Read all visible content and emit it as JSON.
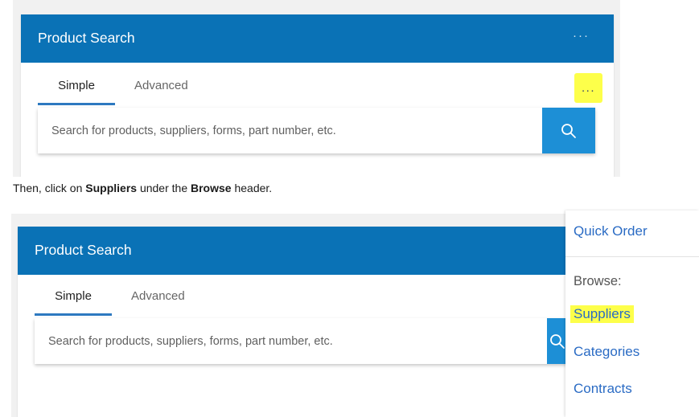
{
  "screenshot1": {
    "title": "Product Search",
    "header_menu": "···",
    "tabs": [
      "Simple",
      "Advanced"
    ],
    "more_menu": "...",
    "search_placeholder": "Search for products, suppliers, forms, part number, etc."
  },
  "instruction": {
    "part1": "Then, click on ",
    "bold1": "Suppliers",
    "part2": " under the ",
    "bold2": "Browse",
    "part3": " header."
  },
  "screenshot2": {
    "title": "Product Search",
    "tabs": [
      "Simple",
      "Advanced"
    ],
    "search_placeholder": "Search for products, suppliers, forms, part number, etc."
  },
  "dropdown": {
    "quick_order": "Quick Order",
    "browse_label": "Browse:",
    "items": [
      "Suppliers",
      "Categories",
      "Contracts"
    ]
  },
  "colors": {
    "header": "#0a72b6",
    "search_button": "#1d8fd6",
    "link": "#2a6bc4",
    "highlight": "#fdff4a",
    "tab_underline": "#2d79c0"
  },
  "icons": {
    "search": "search-icon",
    "more": "more-horizontal-icon"
  }
}
